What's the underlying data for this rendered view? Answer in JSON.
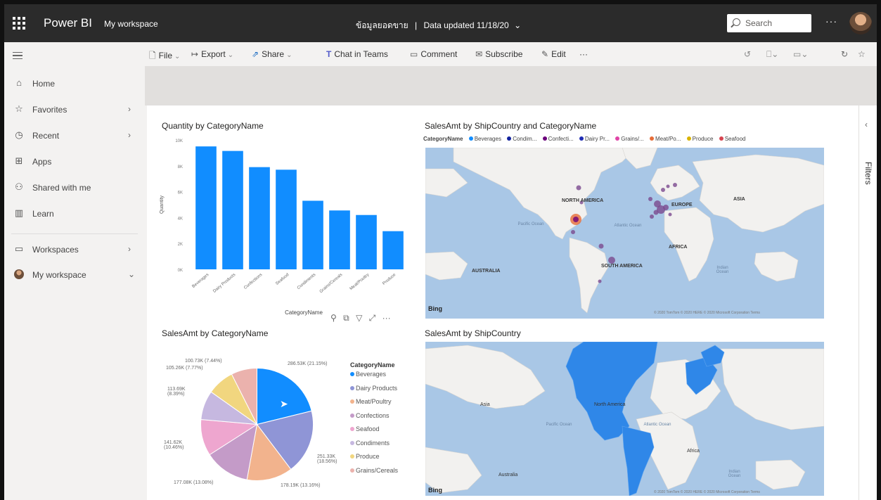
{
  "header": {
    "brand": "Power BI",
    "workspace": "My workspace",
    "report_title": "ข้อมูลยอดขาย",
    "data_updated": "Data updated 11/18/20",
    "search_placeholder": "Search",
    "more": "···"
  },
  "sidebar": {
    "items": [
      {
        "label": "Home",
        "icon": "home-icon"
      },
      {
        "label": "Favorites",
        "icon": "star-icon"
      },
      {
        "label": "Recent",
        "icon": "clock-icon"
      },
      {
        "label": "Apps",
        "icon": "apps-icon"
      },
      {
        "label": "Shared with me",
        "icon": "shared-icon"
      },
      {
        "label": "Learn",
        "icon": "book-icon"
      },
      {
        "label": "Workspaces",
        "icon": "workspaces-icon"
      },
      {
        "label": "My workspace",
        "icon": "avatar"
      }
    ]
  },
  "toolbar": {
    "file": "File",
    "export": "Export",
    "share": "Share",
    "chat": "Chat in Teams",
    "comment": "Comment",
    "subscribe": "Subscribe",
    "edit": "Edit",
    "more": "···"
  },
  "filters_label": "Filters",
  "visuals": {
    "bar": {
      "title": "Quantity by CategoryName",
      "xlabel": "CategoryName",
      "ylabel": "Quantity"
    },
    "map1": {
      "title": "SalesAmt by ShipCountry and CategoryName",
      "legend_title": "CategoryName",
      "legend": [
        {
          "label": "Beverages",
          "color": "#118dff"
        },
        {
          "label": "Condim...",
          "color": "#12239e"
        },
        {
          "label": "Confecti...",
          "color": "#6b007b"
        },
        {
          "label": "Dairy Pr...",
          "color": "#1f2cb4"
        },
        {
          "label": "Grains/...",
          "color": "#e044a7"
        },
        {
          "label": "Meat/Po...",
          "color": "#e66c37"
        },
        {
          "label": "Produce",
          "color": "#d9b300"
        },
        {
          "label": "Seafood",
          "color": "#d64550"
        }
      ],
      "labels": {
        "north_america": "NORTH AMERICA",
        "europe": "EUROPE",
        "asia": "ASIA",
        "africa": "AFRICA",
        "south_america": "SOUTH AMERICA",
        "australia": "AUSTRALIA",
        "pacific": "Pacific Ocean",
        "atlantic": "Atlantic Ocean",
        "indian": "Indian Ocean"
      },
      "bing": "Bing",
      "copyright": "© 2020 TomTom © 2020 HERE © 2020 Microsoft Corporation Terms"
    },
    "pie": {
      "title": "SalesAmt by CategoryName",
      "legend_title": "CategoryName"
    },
    "map2": {
      "title": "SalesAmt by ShipCountry",
      "labels": {
        "asia": "Asia",
        "north_america": "North America",
        "pacific": "Pacific Ocean",
        "atlantic": "Atlantic Ocean",
        "africa": "Africa",
        "indian": "Indian Ocean",
        "australia": "Australia"
      },
      "bing": "Bing",
      "copyright": "© 2020 TomTom © 2020 HERE © 2020 Microsoft Corporation Terms"
    }
  },
  "chart_data": [
    {
      "type": "bar",
      "title": "Quantity by CategoryName",
      "xlabel": "CategoryName",
      "ylabel": "Quantity",
      "categories": [
        "Beverages",
        "Dairy Products",
        "Confections",
        "Seafood",
        "Condiments",
        "Grains/Cereals",
        "Meat/Poultry",
        "Produce"
      ],
      "values": [
        9500,
        9150,
        7900,
        7700,
        5300,
        4550,
        4200,
        2950
      ],
      "ylim": [
        0,
        10000
      ],
      "yticks": [
        "0K",
        "2K",
        "4K",
        "6K",
        "8K",
        "10K"
      ],
      "color": "#118dff",
      "grid": false
    },
    {
      "type": "pie",
      "title": "SalesAmt by CategoryName",
      "legend_title": "CategoryName",
      "legend_position": "right",
      "slices": [
        {
          "label": "Beverages",
          "value": 286.53,
          "text": "286.53K (21.15%)",
          "color": "#118dff"
        },
        {
          "label": "Dairy Products",
          "value": 251.33,
          "text": "251.33K (18.56%)",
          "color": "#8f95d6"
        },
        {
          "label": "Meat/Poultry",
          "value": 178.19,
          "text": "178.19K (13.16%)",
          "color": "#f2b38d"
        },
        {
          "label": "Confections",
          "value": 177.08,
          "text": "177.08K (13.08%)",
          "color": "#c49bc8"
        },
        {
          "label": "Seafood",
          "value": 141.62,
          "text": "141.62K (10.46%)",
          "color": "#eea6cf"
        },
        {
          "label": "Condiments",
          "value": 113.69,
          "text": "113.69K (8.39%)",
          "color": "#c6b8e0"
        },
        {
          "label": "Produce",
          "value": 105.27,
          "text": "105.26K (7.77%)",
          "color": "#f1d67f"
        },
        {
          "label": "Grains/Cereals",
          "value": 100.73,
          "text": "100.73K (7.44%)",
          "color": "#ebb2ad"
        }
      ]
    }
  ]
}
